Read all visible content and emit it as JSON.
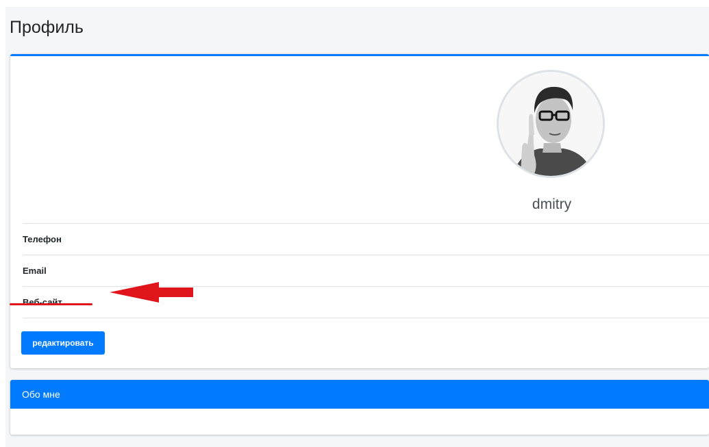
{
  "page": {
    "title": "Профиль"
  },
  "profile": {
    "username": "dmitry",
    "avatar_icon": "user-avatar-photo",
    "fields": [
      {
        "label": "Телефон"
      },
      {
        "label": "Email"
      },
      {
        "label": "Веб-сайт"
      }
    ],
    "edit_label": "редактировать"
  },
  "about": {
    "title": "Обо мне"
  },
  "colors": {
    "accent": "#007bff",
    "annotation": "#e0151b"
  }
}
